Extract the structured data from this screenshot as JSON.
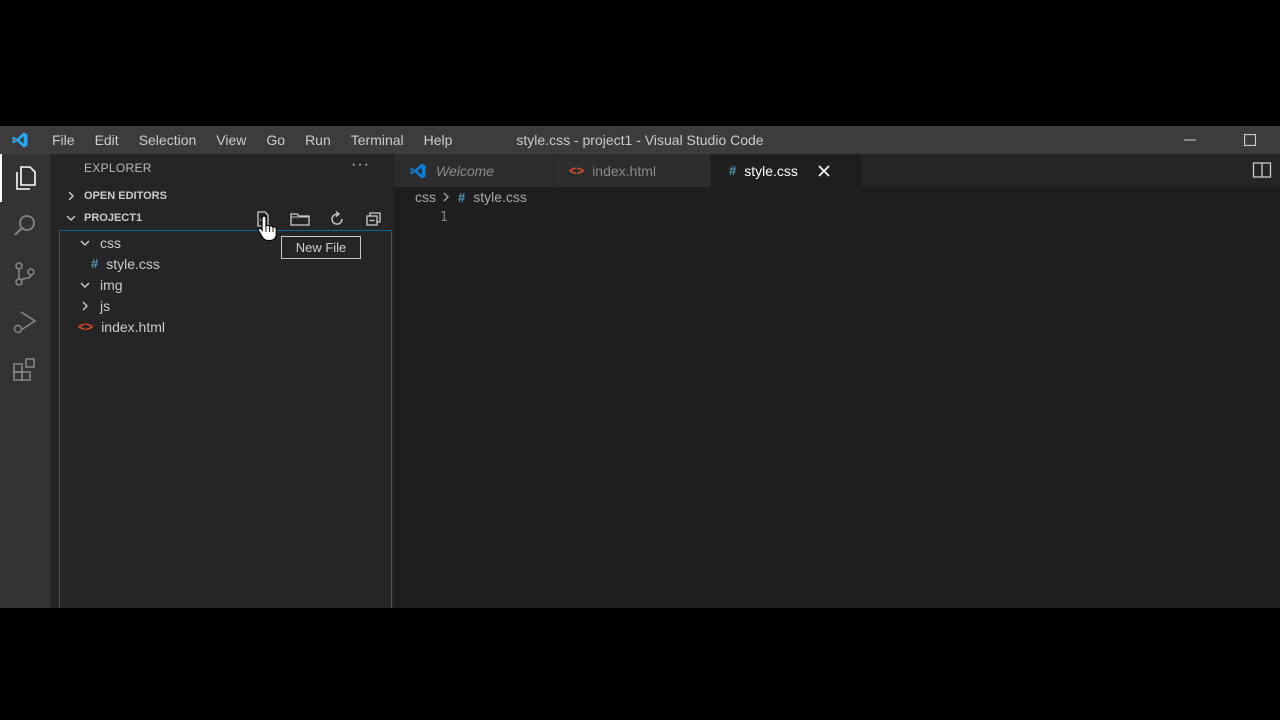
{
  "titlebar": {
    "menu": [
      "File",
      "Edit",
      "Selection",
      "View",
      "Go",
      "Run",
      "Terminal",
      "Help"
    ],
    "window_title": "style.css - project1 - Visual Studio Code"
  },
  "activity_bar": {
    "icons": [
      "explorer-icon",
      "search-icon",
      "source-control-icon",
      "run-debug-icon",
      "extensions-icon"
    ]
  },
  "sidebar": {
    "header": "EXPLORER",
    "more_actions": "···",
    "open_editors_label": "OPEN EDITORS",
    "project_label": "PROJECT1",
    "project_actions": [
      "new-file-icon",
      "new-folder-icon",
      "refresh-icon",
      "collapse-all-icon"
    ],
    "tree": [
      {
        "label": "css",
        "type": "folder",
        "expanded": true
      },
      {
        "label": "style.css",
        "type": "css-file"
      },
      {
        "label": "img",
        "type": "folder",
        "expanded": true
      },
      {
        "label": "js",
        "type": "folder",
        "expanded": false
      },
      {
        "label": "index.html",
        "type": "html-file"
      }
    ]
  },
  "tooltip": {
    "text": "New File"
  },
  "tabs": [
    {
      "label": "Welcome",
      "icon": "vscode-icon",
      "active": false,
      "italic": true
    },
    {
      "label": "index.html",
      "icon": "html-file-icon",
      "active": false
    },
    {
      "label": "style.css",
      "icon": "css-file-icon",
      "active": true
    }
  ],
  "breadcrumb": {
    "folder": "css",
    "file": "style.css"
  },
  "editor": {
    "line_number": "1"
  },
  "colors": {
    "accent": "#007acc",
    "css_icon": "#519aba",
    "html_icon": "#e44d26",
    "vscode_blue": "#0e7fd6"
  }
}
